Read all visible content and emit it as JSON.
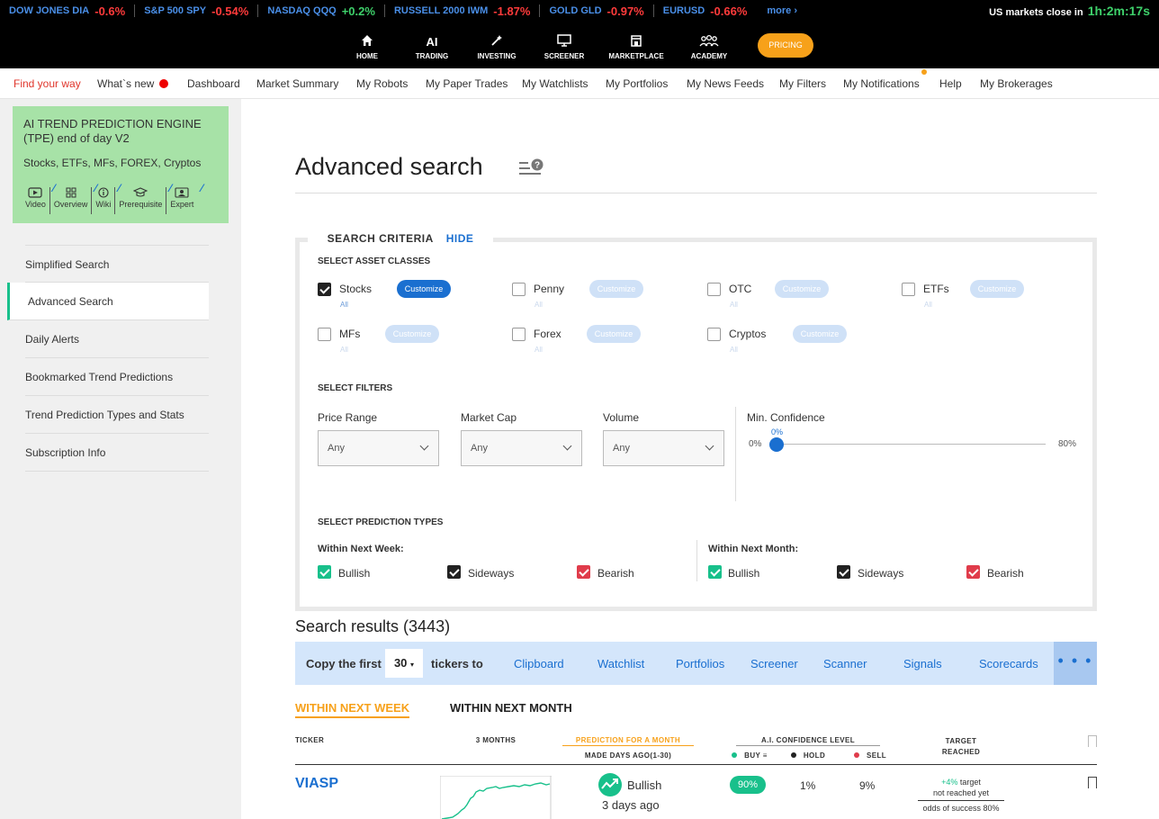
{
  "ticker_bar": {
    "items": [
      {
        "symbol": "DOW JONES DIA",
        "change": "-0.6%",
        "direction": "down"
      },
      {
        "symbol": "S&P 500 SPY",
        "change": "-0.54%",
        "direction": "down"
      },
      {
        "symbol": "NASDAQ QQQ",
        "change": "+0.2%",
        "direction": "up"
      },
      {
        "symbol": "RUSSELL 2000 IWM",
        "change": "-1.87%",
        "direction": "down"
      },
      {
        "symbol": "GOLD GLD",
        "change": "-0.97%",
        "direction": "down"
      },
      {
        "symbol": "EURUSD",
        "change": "-0.66%",
        "direction": "down"
      }
    ],
    "more_label": "more ›",
    "market_close_label": "US markets close in",
    "market_close_timer": "1h:2m:17s"
  },
  "main_nav": {
    "items": [
      {
        "label": "HOME",
        "icon": "home-icon"
      },
      {
        "label": "TRADING",
        "icon": "ai-icon",
        "icon_text": "AI"
      },
      {
        "label": "INVESTING",
        "icon": "magic-wand-icon"
      },
      {
        "label": "SCREENER",
        "icon": "monitor-icon"
      },
      {
        "label": "MARKETPLACE",
        "icon": "store-icon"
      },
      {
        "label": "ACADEMY",
        "icon": "people-icon"
      }
    ],
    "pricing_label": "PRICING"
  },
  "sub_nav": {
    "items": [
      "Find your way",
      "What`s new",
      "Dashboard",
      "Market Summary",
      "My Robots",
      "My Paper Trades",
      "My Watchlists",
      "My Portfolios",
      "My News Feeds",
      "My Filters",
      "My Notifications",
      "Help",
      "My Brokerages"
    ]
  },
  "sidebar": {
    "engine_title": "AI TREND PREDICTION ENGINE (TPE) end of day V2",
    "engine_assets": "Stocks, ETFs, MFs, FOREX, Cryptos",
    "engine_links": [
      {
        "label": "Video",
        "icon": "video-icon"
      },
      {
        "label": "Overview",
        "icon": "grid-icon"
      },
      {
        "label": "Wiki",
        "icon": "info-icon"
      },
      {
        "label": "Prerequisite",
        "icon": "graduation-cap-icon"
      },
      {
        "label": "Expert",
        "icon": "expert-icon"
      }
    ],
    "items": [
      "Simplified Search",
      "Advanced Search",
      "Daily Alerts",
      "Bookmarked Trend Predictions",
      "Trend Prediction Types and Stats",
      "Subscription Info"
    ],
    "active_index": 1
  },
  "page": {
    "title": "Advanced search"
  },
  "criteria": {
    "heading": "SEARCH CRITERIA",
    "hide_label": "HIDE",
    "asset_section": "SELECT ASSET CLASSES",
    "assets": [
      {
        "name": "Stocks",
        "checked": true,
        "all_label": "All",
        "customize": "Customize"
      },
      {
        "name": "Penny",
        "checked": false,
        "all_label": "All",
        "customize": "Customize"
      },
      {
        "name": "OTC",
        "checked": false,
        "all_label": "All",
        "customize": "Customize"
      },
      {
        "name": "ETFs",
        "checked": false,
        "all_label": "All",
        "customize": "Customize"
      },
      {
        "name": "MFs",
        "checked": false,
        "all_label": "All",
        "customize": "Customize"
      },
      {
        "name": "Forex",
        "checked": false,
        "all_label": "All",
        "customize": "Customize"
      },
      {
        "name": "Cryptos",
        "checked": false,
        "all_label": "All",
        "customize": "Customize"
      }
    ],
    "filters_section": "SELECT FILTERS",
    "filters": [
      {
        "label": "Price Range",
        "value": "Any"
      },
      {
        "label": "Market Cap",
        "value": "Any"
      },
      {
        "label": "Volume",
        "value": "Any"
      }
    ],
    "confidence": {
      "label": "Min. Confidence",
      "value": "0%",
      "min": "0%",
      "max": "80%"
    },
    "prediction_section": "SELECT PREDICTION TYPES",
    "week_label": "Within Next Week:",
    "month_label": "Within Next Month:",
    "week_options": [
      "Bullish",
      "Sideways",
      "Bearish"
    ],
    "month_options": [
      "Bullish",
      "Sideways",
      "Bearish"
    ]
  },
  "results": {
    "title": "Search results (3443)",
    "copy_first": "Copy the first",
    "count": "30",
    "tickers_to": "tickers to",
    "targets": [
      "Clipboard",
      "Watchlist",
      "Portfolios",
      "Screener",
      "Scanner",
      "Signals",
      "Scorecards"
    ],
    "more_dots": "• • •",
    "tabs": [
      "WITHIN NEXT WEEK",
      "WITHIN NEXT MONTH"
    ],
    "columns": {
      "ticker": "TICKER",
      "months": "3 MONTHS",
      "prediction": "PREDICTION FOR A MONTH",
      "made": "MADE DAYS AGO(1-30)",
      "confidence": "A.I. CONFIDENCE LEVEL",
      "buy": "BUY",
      "hold": "HOLD",
      "sell": "SELL",
      "target": "TARGET REACHED"
    },
    "rows": [
      {
        "ticker": "VIASP",
        "prediction": "Bullish",
        "made": "3 days ago",
        "buy": "90%",
        "hold": "1%",
        "sell": "9%",
        "target_pct": "+4%",
        "target_text": "target",
        "target_status": "not reached yet",
        "odds": "odds of success 80%"
      }
    ]
  },
  "colors": {
    "accent_blue": "#1a6fd0",
    "green": "#18c08b",
    "orange": "#f7a11a",
    "red": "#e03c4b",
    "engine_green": "#a7e2a7"
  }
}
